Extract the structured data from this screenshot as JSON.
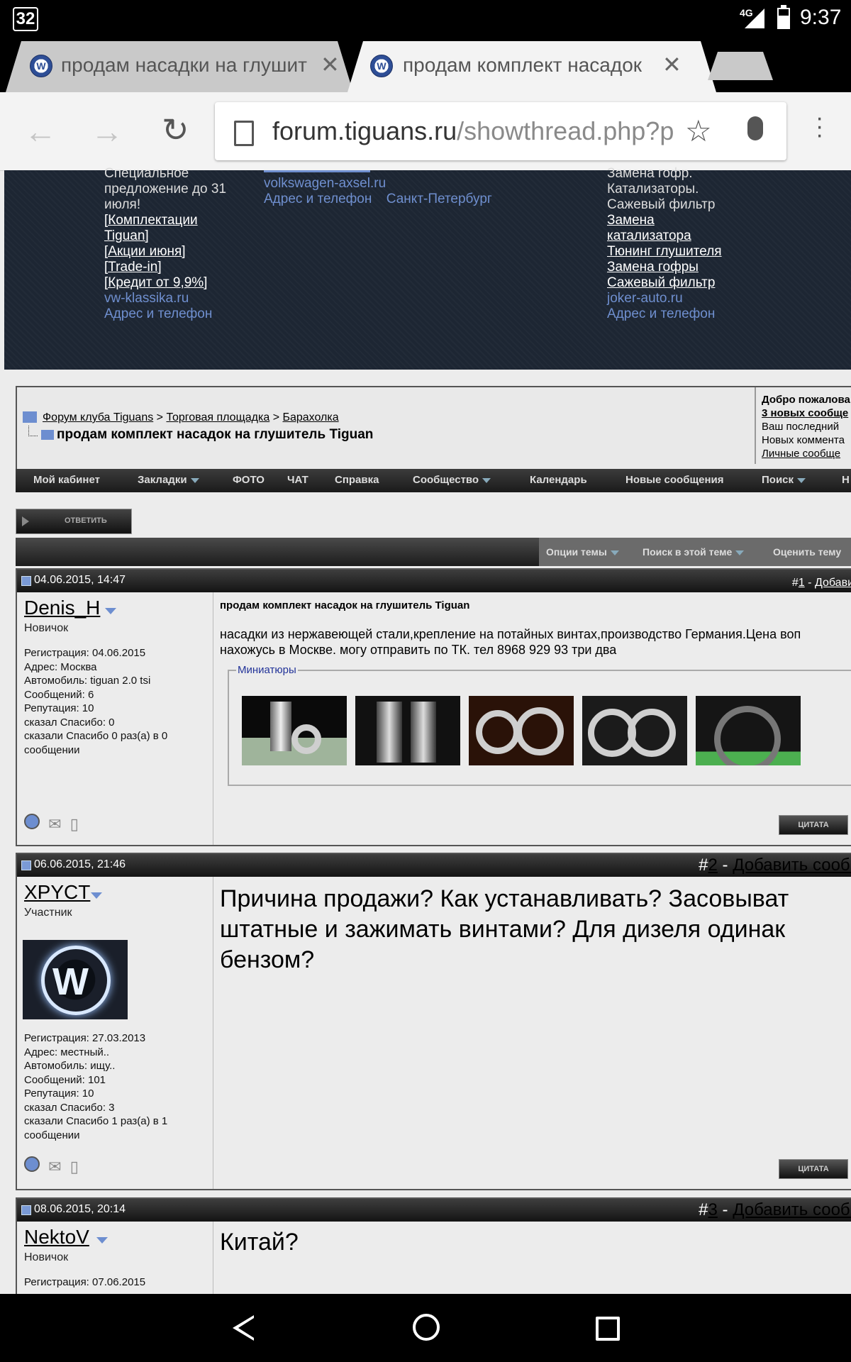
{
  "status_bar": {
    "notification_count": "32",
    "network": "4G",
    "time": "9:37"
  },
  "browser": {
    "tabs": [
      {
        "title": "продам насадки на глушит",
        "active": false
      },
      {
        "title": "продам комплект насадок",
        "active": true
      }
    ],
    "url_domain": "forum.tiguans.ru",
    "url_path": "/showthread.php?p"
  },
  "banner": {
    "col1_text": [
      "Специальное",
      "предложение до 31",
      "июля!"
    ],
    "col1_links": [
      "[Комплектации",
      "Tiguan]",
      "[Акции июня]",
      "[Trade-in]",
      "[Кредит от 9,9%]"
    ],
    "col1_site": "vw-klassika.ru",
    "col1_contact": "Адрес и телефон",
    "col2_site": "volkswagen-axsel.ru",
    "col2_contact": "Адрес и телефон",
    "col2_city": "Санкт-Петербург",
    "col3_text": [
      "Замена гофр.",
      "Катализаторы.",
      "Сажевый фильтр"
    ],
    "col3_links": [
      "Замена",
      "катализатора",
      "Тюнинг глушителя",
      "Замена гофры",
      "Сажевый фильтр"
    ],
    "col3_site": "joker-auto.ru",
    "col3_contact": "Адрес и телефон"
  },
  "breadcrumb": {
    "items": [
      "Форум клуба Tiguans",
      "Торговая площадка",
      "Барахолка"
    ],
    "separator": ">"
  },
  "thread_title": "продам комплект насадок на глушитель Tiguan",
  "welcome": [
    "Добро пожалова",
    "3 новых сообще",
    "Ваш последний",
    "Новых коммента",
    "Личные сообще"
  ],
  "menu": [
    "Мой кабинет",
    "Закладки",
    "ФОТО",
    "ЧАТ",
    "Справка",
    "Сообщество",
    "Календарь",
    "Новые сообщения",
    "Поиск",
    "Н"
  ],
  "reply_button": "ОТВЕТИТЬ",
  "thread_tools": [
    "Опции темы",
    "Поиск в этой теме",
    "Оценить тему"
  ],
  "quote_label": "ЦИТАТА",
  "posts": [
    {
      "date": "04.06.2015, 14:47",
      "number_prefix": "#",
      "number": "1",
      "number_link": "Добави",
      "username": "Denis_H",
      "user_title": "Новичок",
      "info": [
        "Регистрация: 04.06.2015",
        "Адрес: Москва",
        "Автомобиль: tiguan 2.0 tsi",
        "Сообщений: 6",
        "Репутация: 10",
        "сказал Спасибо: 0",
        "сказали Спасибо 0 раз(а) в 0 сообщении"
      ],
      "subject": "продам комплект насадок на глушитель Tiguan",
      "body_lines": [
        "насадки из нержавеющей стали,крепление на потайных винтах,производство Германия.Цена воп",
        "нахожусь в Москве. могу отправить по ТК. тел 8968 929 93 три два"
      ],
      "thumbnails_legend": "Миниатюры"
    },
    {
      "date": "06.06.2015, 21:46",
      "number_prefix": "#",
      "number": "2",
      "number_link": "Добавить сообі",
      "username": "XPYCT",
      "user_title": "Участник",
      "info": [
        "Регистрация: 27.03.2013",
        "Адрес: местный..",
        "Автомобиль: ищу..",
        "Сообщений: 101",
        "Репутация: 10",
        "сказал Спасибо: 3",
        "сказали Спасибо 1 раз(а) в 1 сообщении"
      ],
      "body_lines": [
        "Причина продажи? Как устанавливать? Засовыват",
        "штатные и зажимать винтами? Для дизеля одинак",
        "бензом?"
      ]
    },
    {
      "date": "08.06.2015, 20:14",
      "number_prefix": "#",
      "number": "3",
      "number_link": "Добавить сообі",
      "username": "NektoV",
      "user_title": "Новичок",
      "info": [
        "Регистрация: 07.06.2015"
      ],
      "body_lines": [
        "Китай?"
      ]
    }
  ]
}
